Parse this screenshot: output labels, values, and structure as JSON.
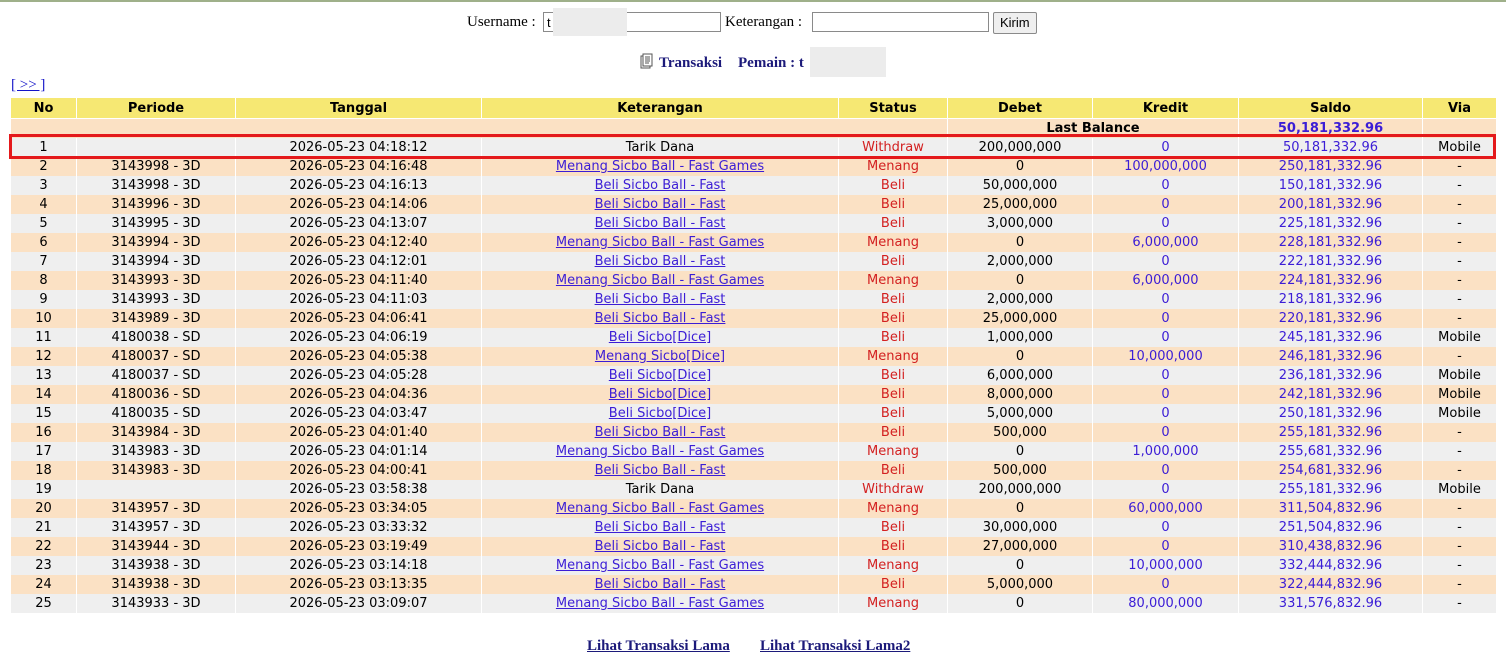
{
  "form": {
    "username_label": "Username :",
    "username_value": "t",
    "keterangan_label": "Keterangan :",
    "keterangan_value": "",
    "submit_label": "Kirim"
  },
  "title": {
    "transaksi": "Transaksi",
    "pemain_label": "Pemain : t"
  },
  "nav": {
    "next_label": "[ >> ]"
  },
  "columns": [
    "No",
    "Periode",
    "Tanggal",
    "Keterangan",
    "Status",
    "Debet",
    "Kredit",
    "Saldo",
    "Via"
  ],
  "last_balance": {
    "label": "Last Balance",
    "value": "50,181,332.96"
  },
  "rows": [
    {
      "no": "1",
      "periode": "",
      "tanggal": "2026-05-23 04:18:12",
      "keterangan": "Tarik Dana",
      "link": false,
      "status": "Withdraw",
      "debet": "200,000,000",
      "kredit": "0",
      "saldo": "50,181,332.96",
      "via": "Mobile"
    },
    {
      "no": "2",
      "periode": "3143998 - 3D",
      "tanggal": "2026-05-23 04:16:48",
      "keterangan": "Menang Sicbo Ball - Fast Games",
      "link": true,
      "status": "Menang",
      "debet": "0",
      "kredit": "100,000,000",
      "saldo": "250,181,332.96",
      "via": "-"
    },
    {
      "no": "3",
      "periode": "3143998 - 3D",
      "tanggal": "2026-05-23 04:16:13",
      "keterangan": "Beli Sicbo Ball - Fast",
      "link": true,
      "status": "Beli",
      "debet": "50,000,000",
      "kredit": "0",
      "saldo": "150,181,332.96",
      "via": "-"
    },
    {
      "no": "4",
      "periode": "3143996 - 3D",
      "tanggal": "2026-05-23 04:14:06",
      "keterangan": "Beli Sicbo Ball - Fast",
      "link": true,
      "status": "Beli",
      "debet": "25,000,000",
      "kredit": "0",
      "saldo": "200,181,332.96",
      "via": "-"
    },
    {
      "no": "5",
      "periode": "3143995 - 3D",
      "tanggal": "2026-05-23 04:13:07",
      "keterangan": "Beli Sicbo Ball - Fast",
      "link": true,
      "status": "Beli",
      "debet": "3,000,000",
      "kredit": "0",
      "saldo": "225,181,332.96",
      "via": "-"
    },
    {
      "no": "6",
      "periode": "3143994 - 3D",
      "tanggal": "2026-05-23 04:12:40",
      "keterangan": "Menang Sicbo Ball - Fast Games",
      "link": true,
      "status": "Menang",
      "debet": "0",
      "kredit": "6,000,000",
      "saldo": "228,181,332.96",
      "via": "-"
    },
    {
      "no": "7",
      "periode": "3143994 - 3D",
      "tanggal": "2026-05-23 04:12:01",
      "keterangan": "Beli Sicbo Ball - Fast",
      "link": true,
      "status": "Beli",
      "debet": "2,000,000",
      "kredit": "0",
      "saldo": "222,181,332.96",
      "via": "-"
    },
    {
      "no": "8",
      "periode": "3143993 - 3D",
      "tanggal": "2026-05-23 04:11:40",
      "keterangan": "Menang Sicbo Ball - Fast Games",
      "link": true,
      "status": "Menang",
      "debet": "0",
      "kredit": "6,000,000",
      "saldo": "224,181,332.96",
      "via": "-"
    },
    {
      "no": "9",
      "periode": "3143993 - 3D",
      "tanggal": "2026-05-23 04:11:03",
      "keterangan": "Beli Sicbo Ball - Fast",
      "link": true,
      "status": "Beli",
      "debet": "2,000,000",
      "kredit": "0",
      "saldo": "218,181,332.96",
      "via": "-"
    },
    {
      "no": "10",
      "periode": "3143989 - 3D",
      "tanggal": "2026-05-23 04:06:41",
      "keterangan": "Beli Sicbo Ball - Fast",
      "link": true,
      "status": "Beli",
      "debet": "25,000,000",
      "kredit": "0",
      "saldo": "220,181,332.96",
      "via": "-"
    },
    {
      "no": "11",
      "periode": "4180038 - SD",
      "tanggal": "2026-05-23 04:06:19",
      "keterangan": "Beli Sicbo[Dice]",
      "link": true,
      "status": "Beli",
      "debet": "1,000,000",
      "kredit": "0",
      "saldo": "245,181,332.96",
      "via": "Mobile"
    },
    {
      "no": "12",
      "periode": "4180037 - SD",
      "tanggal": "2026-05-23 04:05:38",
      "keterangan": "Menang Sicbo[Dice]",
      "link": true,
      "status": "Menang",
      "debet": "0",
      "kredit": "10,000,000",
      "saldo": "246,181,332.96",
      "via": "-"
    },
    {
      "no": "13",
      "periode": "4180037 - SD",
      "tanggal": "2026-05-23 04:05:28",
      "keterangan": "Beli Sicbo[Dice]",
      "link": true,
      "status": "Beli",
      "debet": "6,000,000",
      "kredit": "0",
      "saldo": "236,181,332.96",
      "via": "Mobile"
    },
    {
      "no": "14",
      "periode": "4180036 - SD",
      "tanggal": "2026-05-23 04:04:36",
      "keterangan": "Beli Sicbo[Dice]",
      "link": true,
      "status": "Beli",
      "debet": "8,000,000",
      "kredit": "0",
      "saldo": "242,181,332.96",
      "via": "Mobile"
    },
    {
      "no": "15",
      "periode": "4180035 - SD",
      "tanggal": "2026-05-23 04:03:47",
      "keterangan": "Beli Sicbo[Dice]",
      "link": true,
      "status": "Beli",
      "debet": "5,000,000",
      "kredit": "0",
      "saldo": "250,181,332.96",
      "via": "Mobile"
    },
    {
      "no": "16",
      "periode": "3143984 - 3D",
      "tanggal": "2026-05-23 04:01:40",
      "keterangan": "Beli Sicbo Ball - Fast",
      "link": true,
      "status": "Beli",
      "debet": "500,000",
      "kredit": "0",
      "saldo": "255,181,332.96",
      "via": "-"
    },
    {
      "no": "17",
      "periode": "3143983 - 3D",
      "tanggal": "2026-05-23 04:01:14",
      "keterangan": "Menang Sicbo Ball - Fast Games",
      "link": true,
      "status": "Menang",
      "debet": "0",
      "kredit": "1,000,000",
      "saldo": "255,681,332.96",
      "via": "-"
    },
    {
      "no": "18",
      "periode": "3143983 - 3D",
      "tanggal": "2026-05-23 04:00:41",
      "keterangan": "Beli Sicbo Ball - Fast",
      "link": true,
      "status": "Beli",
      "debet": "500,000",
      "kredit": "0",
      "saldo": "254,681,332.96",
      "via": "-"
    },
    {
      "no": "19",
      "periode": "",
      "tanggal": "2026-05-23 03:58:38",
      "keterangan": "Tarik Dana",
      "link": false,
      "status": "Withdraw",
      "debet": "200,000,000",
      "kredit": "0",
      "saldo": "255,181,332.96",
      "via": "Mobile"
    },
    {
      "no": "20",
      "periode": "3143957 - 3D",
      "tanggal": "2026-05-23 03:34:05",
      "keterangan": "Menang Sicbo Ball - Fast Games",
      "link": true,
      "status": "Menang",
      "debet": "0",
      "kredit": "60,000,000",
      "saldo": "311,504,832.96",
      "via": "-"
    },
    {
      "no": "21",
      "periode": "3143957 - 3D",
      "tanggal": "2026-05-23 03:33:32",
      "keterangan": "Beli Sicbo Ball - Fast",
      "link": true,
      "status": "Beli",
      "debet": "30,000,000",
      "kredit": "0",
      "saldo": "251,504,832.96",
      "via": "-"
    },
    {
      "no": "22",
      "periode": "3143944 - 3D",
      "tanggal": "2026-05-23 03:19:49",
      "keterangan": "Beli Sicbo Ball - Fast",
      "link": true,
      "status": "Beli",
      "debet": "27,000,000",
      "kredit": "0",
      "saldo": "310,438,832.96",
      "via": "-"
    },
    {
      "no": "23",
      "periode": "3143938 - 3D",
      "tanggal": "2026-05-23 03:14:18",
      "keterangan": "Menang Sicbo Ball - Fast Games",
      "link": true,
      "status": "Menang",
      "debet": "0",
      "kredit": "10,000,000",
      "saldo": "332,444,832.96",
      "via": "-"
    },
    {
      "no": "24",
      "periode": "3143938 - 3D",
      "tanggal": "2026-05-23 03:13:35",
      "keterangan": "Beli Sicbo Ball - Fast",
      "link": true,
      "status": "Beli",
      "debet": "5,000,000",
      "kredit": "0",
      "saldo": "322,444,832.96",
      "via": "-"
    },
    {
      "no": "25",
      "periode": "3143933 - 3D",
      "tanggal": "2026-05-23 03:09:07",
      "keterangan": "Menang Sicbo Ball - Fast Games",
      "link": true,
      "status": "Menang",
      "debet": "0",
      "kredit": "80,000,000",
      "saldo": "331,576,832.96",
      "via": "-"
    }
  ],
  "footer": {
    "old_transactions_label": "Lihat Transaksi Lama",
    "old_transactions2_label": "Lihat Transaksi Lama2"
  },
  "colors": {
    "header_bg": "#f6e873",
    "row_odd": "#efefef",
    "row_even": "#fbe1c4",
    "status_red": "#d32020",
    "link_blue": "#3b1dd6",
    "highlight_border": "#e4191b"
  },
  "icons": {
    "title": "document-icon"
  }
}
